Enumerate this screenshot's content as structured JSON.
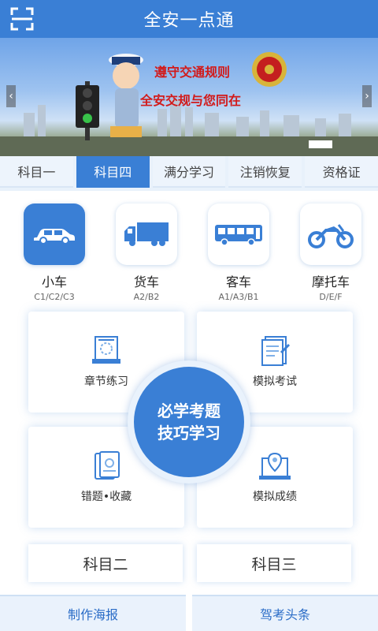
{
  "header": {
    "title": "全安一点通",
    "scan_icon": "scan-icon"
  },
  "banner": {
    "slogan_line1": "遵守交通规则",
    "slogan_line2": "全安交规与您同在"
  },
  "tabs": [
    {
      "label": "科目一",
      "active": false
    },
    {
      "label": "科目四",
      "active": true
    },
    {
      "label": "满分学习",
      "active": false
    },
    {
      "label": "注销恢复",
      "active": false
    },
    {
      "label": "资格证",
      "active": false
    }
  ],
  "vehicles": [
    {
      "name": "小车",
      "code": "C1/C2/C3",
      "icon": "car-icon",
      "active": true
    },
    {
      "name": "货车",
      "code": "A2/B2",
      "icon": "truck-icon",
      "active": false
    },
    {
      "name": "客车",
      "code": "A1/A3/B1",
      "icon": "bus-icon",
      "active": false
    },
    {
      "name": "摩托车",
      "code": "D/E/F",
      "icon": "motorcycle-icon",
      "active": false
    }
  ],
  "study": {
    "chapter_practice": "章节练习",
    "mock_exam": "模拟考试",
    "mistakes_favorites": "错题•收藏",
    "mock_scores": "模拟成绩",
    "center_line1": "必学考题",
    "center_line2": "技巧学习"
  },
  "subjects": {
    "subject2": "科目二",
    "subject3": "科目三"
  },
  "bottom_nav": {
    "poster": "制作海报",
    "news": "驾考头条"
  },
  "colors": {
    "primary": "#3a7fd5",
    "slogan_red": "#d21a1a"
  }
}
